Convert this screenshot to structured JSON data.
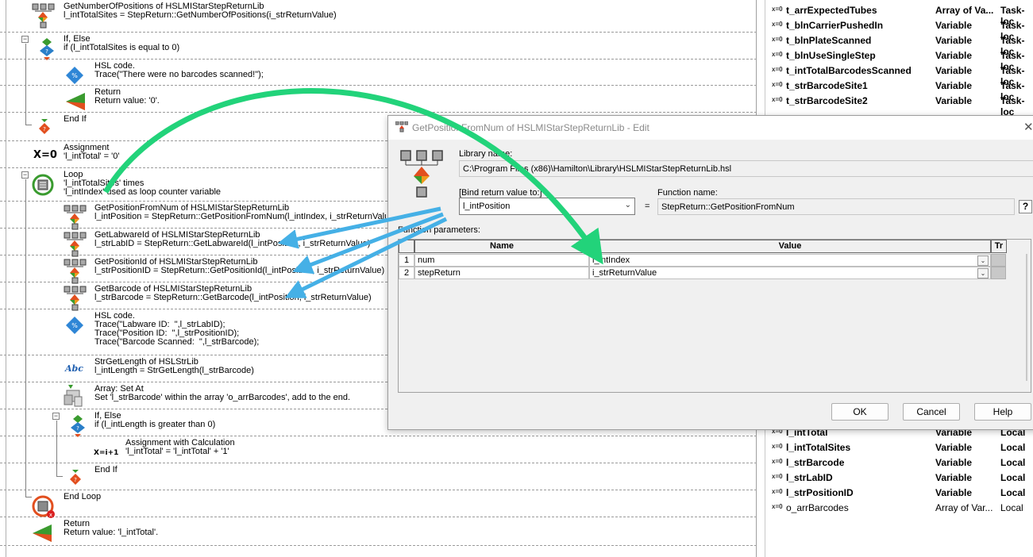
{
  "method_steps": [
    {
      "title": "GetNumberOfPositions of HSLMIStarStepReturnLib",
      "lines": [
        "l_intTotalSites = StepReturn::GetNumberOfPositions(i_strReturnValue)"
      ]
    },
    {
      "title": "If, Else",
      "lines": [
        "if (l_intTotalSites is equal to 0)"
      ]
    },
    {
      "title": "HSL code.",
      "lines": [
        "Trace(\"There were no barcodes scanned!\");"
      ]
    },
    {
      "title": "Return",
      "lines": [
        "Return value: '0'."
      ]
    },
    {
      "title": "End If",
      "lines": []
    },
    {
      "title": "Assignment",
      "lines": [
        "'l_intTotal' = '0'"
      ]
    },
    {
      "title": "Loop",
      "lines": [
        "'l_intTotalSites' times",
        "'l_intIndex' used as loop counter variable"
      ]
    },
    {
      "title": "GetPositionFromNum of HSLMIStarStepReturnLib",
      "lines": [
        "l_intPosition = StepReturn::GetPositionFromNum(l_intIndex, i_strReturnValue)"
      ]
    },
    {
      "title": "GetLabwareId of HSLMIStarStepReturnLib",
      "lines": [
        "l_strLabID = StepReturn::GetLabwareId(l_intPosition, i_strReturnValue)"
      ]
    },
    {
      "title": "GetPositionId of HSLMIStarStepReturnLib",
      "lines": [
        "l_strPositionID = StepReturn::GetPositionId(l_intPosition, i_strReturnValue)"
      ]
    },
    {
      "title": "GetBarcode of HSLMIStarStepReturnLib",
      "lines": [
        "l_strBarcode = StepReturn::GetBarcode(l_intPosition, i_strReturnValue)"
      ]
    },
    {
      "title": "HSL code.",
      "lines": [
        "Trace(\"Labware ID:  \",l_strLabID);",
        "Trace(\"Position ID:  \",l_strPositionID);",
        "Trace(\"Barcode Scanned:  \",l_strBarcode);"
      ]
    },
    {
      "title": "StrGetLength of HSLStrLib",
      "lines": [
        "l_intLength = StrGetLength(l_strBarcode)"
      ]
    },
    {
      "title": "Array: Set At",
      "lines": [
        "Set 'l_strBarcode' within the array 'o_arrBarcodes', add to the end."
      ]
    },
    {
      "title": "If, Else",
      "lines": [
        "if (l_intLength is greater than 0)"
      ]
    },
    {
      "title": "Assignment with Calculation",
      "lines": [
        "'l_intTotal' = 'l_intTotal' + '1'"
      ]
    },
    {
      "title": "End If",
      "lines": []
    },
    {
      "title": "End Loop",
      "lines": []
    },
    {
      "title": "Return",
      "lines": [
        "Return value: 'l_intTotal'."
      ]
    }
  ],
  "icons": {
    "assignment": "X=0",
    "calc": "X=i+1",
    "strlen": "Abc"
  },
  "variables_top": [
    {
      "prefix": "x=0",
      "name": "t_arrExpectedTubes",
      "type": "Array of Va...",
      "scope": "Task-loc"
    },
    {
      "prefix": "x=0",
      "name": "t_blnCarrierPushedIn",
      "type": "Variable",
      "scope": "Task-loc"
    },
    {
      "prefix": "x=0",
      "name": "t_blnPlateScanned",
      "type": "Variable",
      "scope": "Task-loc"
    },
    {
      "prefix": "x=0",
      "name": "t_blnUseSingleStep",
      "type": "Variable",
      "scope": "Task-loc"
    },
    {
      "prefix": "x=0",
      "name": "t_intTotalBarcodesScanned",
      "type": "Variable",
      "scope": "Task-loc"
    },
    {
      "prefix": "x=0",
      "name": "t_strBarcodeSite1",
      "type": "Variable",
      "scope": "Task-loc"
    },
    {
      "prefix": "x=0",
      "name": "t_strBarcodeSite2",
      "type": "Variable",
      "scope": "Task-loc"
    }
  ],
  "variables_bottom": [
    {
      "prefix": "x=0",
      "name": "l_intTotal",
      "type": "Variable",
      "scope": "Local"
    },
    {
      "prefix": "x=0",
      "name": "l_intTotalSites",
      "type": "Variable",
      "scope": "Local"
    },
    {
      "prefix": "x=0",
      "name": "l_strBarcode",
      "type": "Variable",
      "scope": "Local"
    },
    {
      "prefix": "x=0",
      "name": "l_strLabID",
      "type": "Variable",
      "scope": "Local"
    },
    {
      "prefix": "x=0",
      "name": "l_strPositionID",
      "type": "Variable",
      "scope": "Local"
    },
    {
      "prefix": "x=0",
      "name": "o_arrBarcodes",
      "type": "Array of Var...",
      "scope": "Local"
    }
  ],
  "dialog": {
    "title": "GetPositionFromNum of HSLMIStarStepReturnLib - Edit",
    "library_label": "Library name:",
    "library_value": "C:\\Program Files (x86)\\Hamilton\\Library\\HSLMIStarStepReturnLib.hsl",
    "bind_label": "[Bind return value to:]",
    "bind_value": "l_intPosition",
    "equals": "=",
    "function_label": "Function name:",
    "function_value": "StepReturn::GetPositionFromNum",
    "help_glyph": "?",
    "params_label": "Function parameters:",
    "grid_headers": [
      "Name",
      "Value",
      "Tr"
    ],
    "params": [
      {
        "num": "1",
        "name": "num",
        "value": "l_intIndex"
      },
      {
        "num": "2",
        "name": "stepReturn",
        "value": "i_strReturnValue"
      }
    ],
    "ok": "OK",
    "cancel": "Cancel",
    "help": "Help",
    "close": "✕"
  },
  "annotation_colors": {
    "green_arrow": "#22d37a",
    "blue_arrow": "#45b0e6"
  }
}
